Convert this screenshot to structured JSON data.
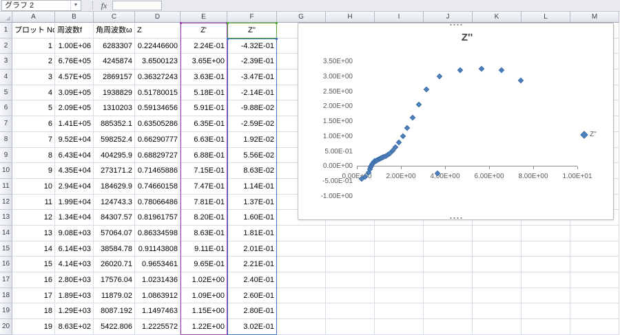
{
  "name_box": {
    "value": "グラフ 2"
  },
  "formula_bar": {
    "fx_label": "fx",
    "value": ""
  },
  "grid": {
    "column_letters": [
      "A",
      "B",
      "C",
      "D",
      "E",
      "F",
      "G",
      "H",
      "I",
      "J",
      "K",
      "L",
      "M"
    ],
    "row_numbers": [
      "1",
      "2",
      "3",
      "4",
      "5",
      "6",
      "7",
      "8",
      "9",
      "10",
      "11",
      "12",
      "13",
      "14",
      "15",
      "16",
      "17",
      "18",
      "19",
      "20"
    ]
  },
  "table": {
    "headers": {
      "plot_no": "プロット No",
      "freq": "周波数f",
      "ang_freq": "角周波数ω",
      "z": "Z",
      "z_re": "Z'",
      "z_im": "Z''"
    },
    "rows": [
      [
        "1",
        "1.00E+06",
        "6283307",
        "0.22446600",
        "2.24E-01",
        "-4.32E-01"
      ],
      [
        "2",
        "6.76E+05",
        "4245874",
        "3.6500123",
        "3.65E+00",
        "-2.39E-01"
      ],
      [
        "3",
        "4.57E+05",
        "2869157",
        "0.36327243",
        "3.63E-01",
        "-3.47E-01"
      ],
      [
        "4",
        "3.09E+05",
        "1938829",
        "0.51780015",
        "5.18E-01",
        "-2.14E-01"
      ],
      [
        "5",
        "2.09E+05",
        "1310203",
        "0.59134656",
        "5.91E-01",
        "-9.88E-02"
      ],
      [
        "6",
        "1.41E+05",
        "885352.1",
        "0.63505286",
        "6.35E-01",
        "-2.59E-02"
      ],
      [
        "7",
        "9.52E+04",
        "598252.4",
        "0.66290777",
        "6.63E-01",
        "1.92E-02"
      ],
      [
        "8",
        "6.43E+04",
        "404295.9",
        "0.68829727",
        "6.88E-01",
        "5.56E-02"
      ],
      [
        "9",
        "4.35E+04",
        "273171.2",
        "0.71465886",
        "7.15E-01",
        "8.63E-02"
      ],
      [
        "10",
        "2.94E+04",
        "184629.9",
        "0.74660158",
        "7.47E-01",
        "1.14E-01"
      ],
      [
        "11",
        "1.99E+04",
        "124743.3",
        "0.78066486",
        "7.81E-01",
        "1.37E-01"
      ],
      [
        "12",
        "1.34E+04",
        "84307.57",
        "0.81961757",
        "8.20E-01",
        "1.60E-01"
      ],
      [
        "13",
        "9.08E+03",
        "57064.07",
        "0.86334598",
        "8.63E-01",
        "1.81E-01"
      ],
      [
        "14",
        "6.14E+03",
        "38584.78",
        "0.91143808",
        "9.11E-01",
        "2.01E-01"
      ],
      [
        "15",
        "4.14E+03",
        "26020.71",
        "0.9653461",
        "9.65E-01",
        "2.21E-01"
      ],
      [
        "16",
        "2.80E+03",
        "17576.04",
        "1.0231436",
        "1.02E+00",
        "2.40E-01"
      ],
      [
        "17",
        "1.89E+03",
        "11879.02",
        "1.0863912",
        "1.09E+00",
        "2.60E-01"
      ],
      [
        "18",
        "1.29E+03",
        "8087.192",
        "1.1497463",
        "1.15E+00",
        "2.80E-01"
      ],
      [
        "19",
        "8.63E+02",
        "5422.806",
        "1.2225572",
        "1.22E+00",
        "3.02E-01"
      ]
    ]
  },
  "highlight_colors": {
    "x_range_purple": "#A03CB4",
    "y_range_blue": "#4472C4",
    "name_range_green": "#4EA72E"
  },
  "chart": {
    "marker_color": "#4F81BD",
    "marker_border": "#3A6DA8",
    "x_ticks": [
      {
        "label": "0.00E+00",
        "value": 0
      },
      {
        "label": "2.00E+00",
        "value": 2
      },
      {
        "label": "4.00E+00",
        "value": 4
      },
      {
        "label": "6.00E+00",
        "value": 6
      },
      {
        "label": "8.00E+00",
        "value": 8
      },
      {
        "label": "1.00E+01",
        "value": 10
      }
    ],
    "y_ticks": [
      {
        "label": "3.50E+00",
        "value": 3.5
      },
      {
        "label": "3.00E+00",
        "value": 3
      },
      {
        "label": "2.50E+00",
        "value": 2.5
      },
      {
        "label": "2.00E+00",
        "value": 2
      },
      {
        "label": "1.50E+00",
        "value": 1.5
      },
      {
        "label": "1.00E+00",
        "value": 1
      },
      {
        "label": "5.00E-01",
        "value": 0.5
      },
      {
        "label": "0.00E+00",
        "value": 0
      },
      {
        "label": "-5.00E-01",
        "value": -0.5
      },
      {
        "label": "-1.00E+00",
        "value": -1
      }
    ]
  },
  "chart_data": {
    "type": "scatter",
    "title": "Z''",
    "xlabel": "",
    "ylabel": "",
    "xlim": [
      0,
      10
    ],
    "ylim": [
      -1,
      3.5
    ],
    "grid": false,
    "legend_position": "right",
    "series": [
      {
        "name": "Z''",
        "points": [
          [
            0.224,
            -0.432
          ],
          [
            3.65,
            -0.239
          ],
          [
            0.363,
            -0.347
          ],
          [
            0.518,
            -0.214
          ],
          [
            0.591,
            -0.099
          ],
          [
            0.635,
            -0.026
          ],
          [
            0.663,
            0.019
          ],
          [
            0.688,
            0.056
          ],
          [
            0.715,
            0.086
          ],
          [
            0.747,
            0.114
          ],
          [
            0.781,
            0.137
          ],
          [
            0.82,
            0.16
          ],
          [
            0.863,
            0.181
          ],
          [
            0.911,
            0.201
          ],
          [
            0.965,
            0.221
          ],
          [
            1.02,
            0.24
          ],
          [
            1.09,
            0.26
          ],
          [
            1.15,
            0.28
          ],
          [
            1.22,
            0.302
          ],
          [
            1.3,
            0.33
          ],
          [
            1.4,
            0.37
          ],
          [
            1.5,
            0.43
          ],
          [
            1.62,
            0.51
          ],
          [
            1.75,
            0.62
          ],
          [
            1.9,
            0.78
          ],
          [
            2.08,
            1.0
          ],
          [
            2.28,
            1.28
          ],
          [
            2.52,
            1.62
          ],
          [
            2.8,
            2.05
          ],
          [
            3.15,
            2.55
          ],
          [
            3.75,
            3.0
          ],
          [
            4.7,
            3.2
          ],
          [
            5.65,
            3.25
          ],
          [
            6.55,
            3.2
          ],
          [
            7.45,
            2.85
          ]
        ]
      }
    ]
  }
}
